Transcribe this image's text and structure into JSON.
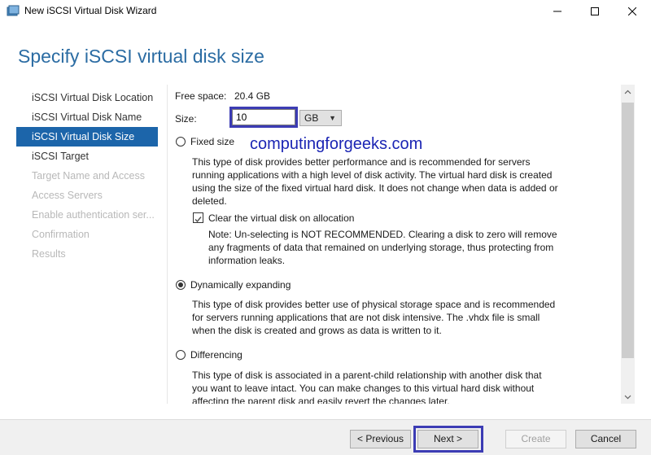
{
  "window": {
    "title": "New iSCSI Virtual Disk Wizard"
  },
  "header": {
    "page_title": "Specify iSCSI virtual disk size"
  },
  "nav": {
    "items": [
      {
        "label": "iSCSI Virtual Disk Location",
        "state": "normal"
      },
      {
        "label": "iSCSI Virtual Disk Name",
        "state": "normal"
      },
      {
        "label": "iSCSI Virtual Disk Size",
        "state": "active"
      },
      {
        "label": "iSCSI Target",
        "state": "normal"
      },
      {
        "label": "Target Name and Access",
        "state": "disabled"
      },
      {
        "label": "Access Servers",
        "state": "disabled"
      },
      {
        "label": "Enable authentication ser...",
        "state": "disabled"
      },
      {
        "label": "Confirmation",
        "state": "disabled"
      },
      {
        "label": "Results",
        "state": "disabled"
      }
    ]
  },
  "form": {
    "free_space_label": "Free space:",
    "free_space_value": "20.4 GB",
    "size_label": "Size:",
    "size_value": "10",
    "unit_value": "GB",
    "fixed": {
      "label": "Fixed size",
      "selected": false,
      "description_lines": [
        "This type of disk provides better performance and is recommended for servers",
        "running applications with a high level of disk activity. The virtual hard disk is created",
        "using the size of the fixed virtual hard disk. It does not change when data is added or",
        "deleted."
      ],
      "clear_label": "Clear the virtual disk on allocation",
      "clear_checked": true,
      "note_lines": [
        "Note: Un-selecting is NOT RECOMMENDED. Clearing a disk to zero will remove",
        "any fragments of data that remained on underlying storage, thus protecting from",
        "information leaks."
      ]
    },
    "dynamic": {
      "label": "Dynamically expanding",
      "selected": true,
      "description_lines": [
        "This type of disk provides better use of physical storage space and is recommended",
        "for servers running applications that are not disk intensive. The .vhdx file is small",
        "when the disk is created and grows as data is written to it."
      ]
    },
    "differencing": {
      "label": "Differencing",
      "selected": false,
      "description_lines": [
        "This type of disk is associated in a parent-child relationship with another disk that",
        "you want to leave intact. You can make changes to this virtual hard disk without",
        "affecting the parent disk and easily revert the changes later."
      ]
    }
  },
  "watermark": "computingforgeeks.com",
  "footer": {
    "previous": "< Previous",
    "next": "Next >",
    "create": "Create",
    "cancel": "Cancel"
  },
  "colors": {
    "title_blue": "#2b6ca3",
    "nav_active": "#1c65aa",
    "highlight_box": "#3c3cb4"
  }
}
